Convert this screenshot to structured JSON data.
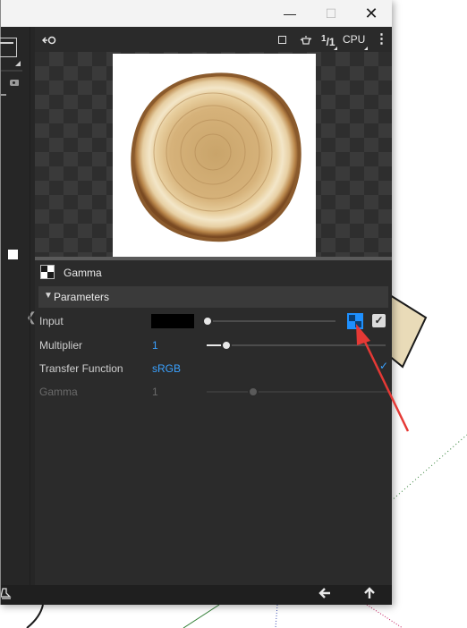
{
  "window": {
    "controls": {
      "minimize": "—",
      "maximize": "☐",
      "close": "✕"
    }
  },
  "viewer_toolbar": {
    "left_icon": "view-link-icon",
    "frame_label": "1/1",
    "frame_top": "1",
    "frame_bottom": "1",
    "device_label": "CPU",
    "more_icon": "⋮"
  },
  "node": {
    "title": "Gamma",
    "section": "Parameters"
  },
  "params": [
    {
      "label": "Input",
      "value": "",
      "type": "color",
      "slider": 0.0
    },
    {
      "label": "Multiplier",
      "value": "1",
      "type": "number",
      "slider": 0.1
    },
    {
      "label": "Transfer Function",
      "value": "sRGB",
      "type": "enum"
    },
    {
      "label": "Gamma",
      "value": "1",
      "type": "number",
      "slider": 0.26,
      "disabled": true
    }
  ],
  "input_checkbox": "✓",
  "bottom": {
    "back_icon": "🡐",
    "up_icon": "🡑"
  },
  "colors": {
    "accent": "#3aa1ff",
    "annotation_arrow": "#e53935",
    "panel_bg": "#2b2b2b"
  }
}
